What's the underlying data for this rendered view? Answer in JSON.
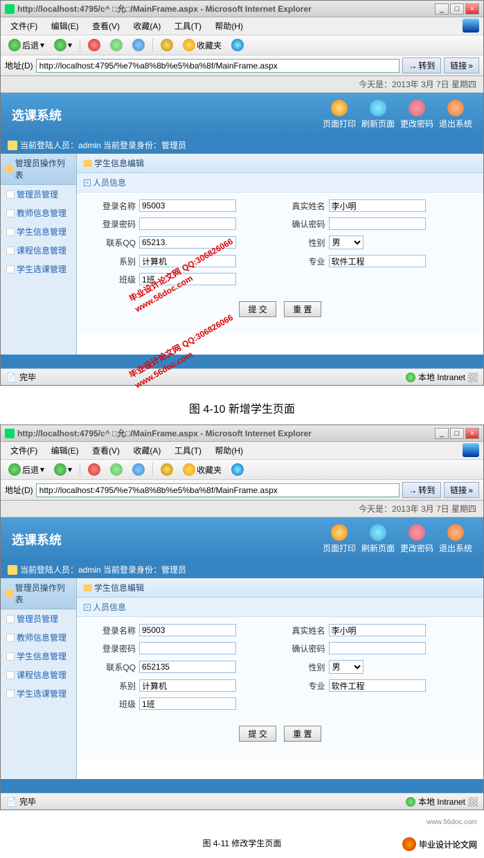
{
  "browser": {
    "title": "http://localhost:4795/c^ □允□/MainFrame.aspx - Microsoft Internet Explorer",
    "menus": [
      "文件(F)",
      "编辑(E)",
      "查看(V)",
      "收藏(A)",
      "工具(T)",
      "帮助(H)"
    ],
    "back": "后退",
    "favorites": "收藏夹",
    "addr_label": "地址(D)",
    "url": "http://localhost:4795/%e7%a8%8b%e5%ba%8f/MainFrame.aspx",
    "go": "转到",
    "links": "链接",
    "status_done": "完毕",
    "status_zone": "本地 Intranet"
  },
  "app": {
    "date_text": "今天是：2013年 3月 7日 星期四",
    "title": "选课系统",
    "user_info": "当前登陆人员：admin 当前登录身份：管理员",
    "header_actions": [
      "页面打印",
      "刷新页面",
      "更改密码",
      "退出系统"
    ]
  },
  "sidebar": {
    "header": "管理员操作列表",
    "items": [
      "管理员管理",
      "教师信息管理",
      "学生信息管理",
      "课程信息管理",
      "学生选课管理"
    ]
  },
  "panel": {
    "title": "学生信息编辑",
    "section": "人员信息"
  },
  "form1": {
    "login_name": {
      "label": "登录名称",
      "value": "95003"
    },
    "real_name": {
      "label": "真实姓名",
      "value": "李小明"
    },
    "login_pwd": {
      "label": "登录密码",
      "value": ""
    },
    "confirm_pwd": {
      "label": "确认密码",
      "value": ""
    },
    "qq": {
      "label": "联系QQ",
      "value": "65213."
    },
    "gender": {
      "label": "性别",
      "value": "男"
    },
    "dept": {
      "label": "系别",
      "value": "计算机"
    },
    "major": {
      "label": "专业",
      "value": "软件工程"
    },
    "class": {
      "label": "班级",
      "value": "1班"
    },
    "submit": "提 交",
    "reset": "重 置"
  },
  "form2": {
    "qq_value": "652135"
  },
  "captions": {
    "fig1": "图 4-10  新增学生页面",
    "fig2": "图 4-11  修改学生页面"
  },
  "watermark": {
    "site": "www.56doc.com",
    "text": "毕业设计论文网",
    "qq": "QQ:306826066"
  }
}
